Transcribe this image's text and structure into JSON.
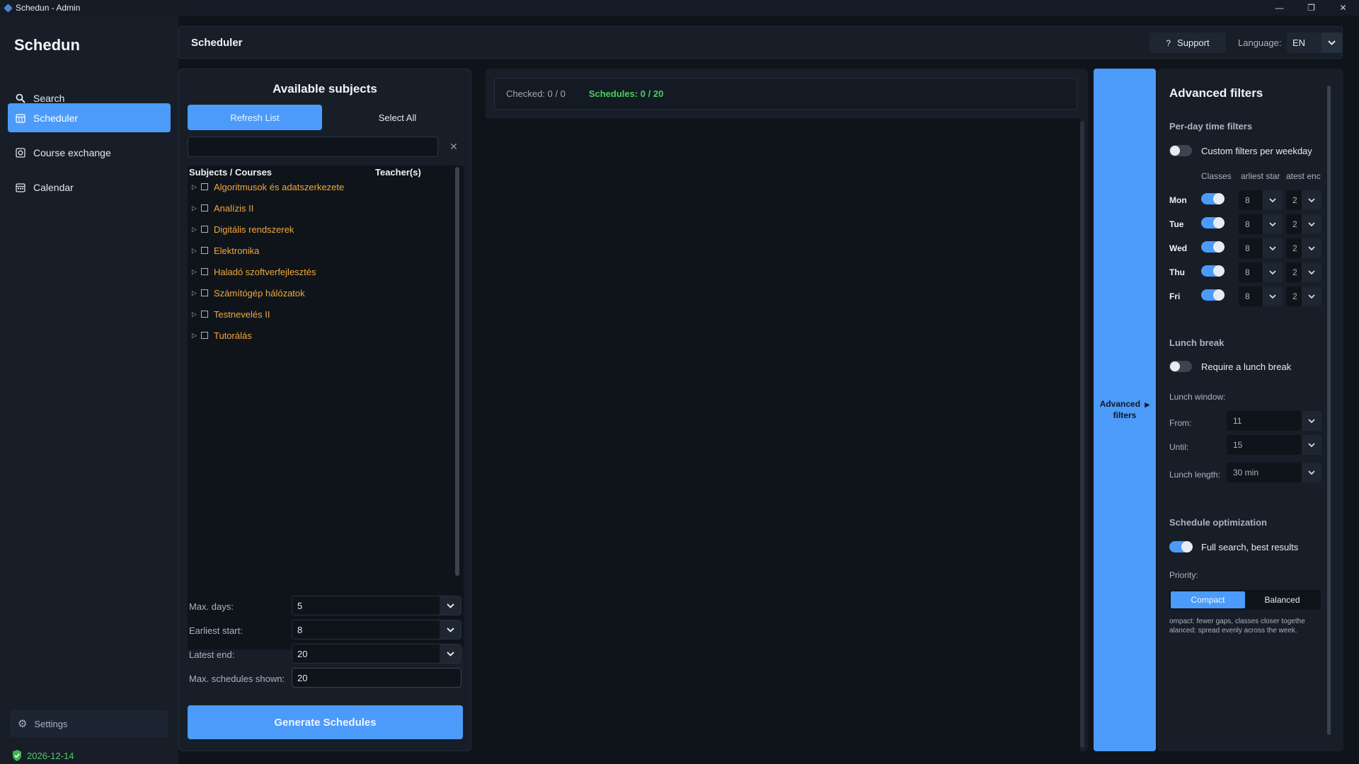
{
  "window": {
    "title": "Schedun - Admin"
  },
  "sidebar": {
    "logo": "Schedun",
    "items": [
      {
        "label": "Search",
        "icon": "search-icon"
      },
      {
        "label": "Scheduler",
        "icon": "calendar-grid-icon",
        "active": true
      },
      {
        "label": "Course exchange",
        "icon": "exchange-icon"
      },
      {
        "label": "Calendar",
        "icon": "calendar-icon"
      }
    ],
    "settings_label": "Settings",
    "license_date": "2026-12-14"
  },
  "header": {
    "title": "Scheduler",
    "support_label": "Support",
    "language_label": "Language:",
    "language_value": "EN"
  },
  "subjects": {
    "title": "Available subjects",
    "refresh_label": "Refresh List",
    "select_all_label": "Select All",
    "search_value": "",
    "col_subjects": "Subjects / Courses",
    "col_teachers": "Teacher(s)",
    "items": [
      "Algoritmusok és adatszerkezete",
      "Analízis II",
      "Digitális rendszerek",
      "Elektronika",
      "Haladó szoftverfejlesztés",
      "Számítógép hálózatok",
      "Testnevelés II",
      "Tutorálás"
    ],
    "fields": {
      "max_days_label": "Max. days:",
      "max_days": "5",
      "earliest_start_label": "Earliest start:",
      "earliest_start": "8",
      "latest_end_label": "Latest end:",
      "latest_end": "20",
      "max_shown_label": "Max. schedules shown:",
      "max_shown": "20"
    },
    "generate_label": "Generate Schedules"
  },
  "results": {
    "checked_text": "Checked: 0 / 0",
    "schedules_text": "Schedules: 0 / 20"
  },
  "advanced": {
    "toggle_label_1": "Advanced",
    "toggle_label_2": "filters",
    "toggle_arrow": "▶",
    "title": "Advanced filters",
    "per_day_title": "Per-day time filters",
    "custom_label": "Custom filters per weekday",
    "col_classes": "Classes",
    "col_start": "arliest star",
    "col_end": "atest enc",
    "days": [
      {
        "name": "Mon",
        "start": "8",
        "end": "2"
      },
      {
        "name": "Tue",
        "start": "8",
        "end": "2"
      },
      {
        "name": "Wed",
        "start": "8",
        "end": "2"
      },
      {
        "name": "Thu",
        "start": "8",
        "end": "2"
      },
      {
        "name": "Fri",
        "start": "8",
        "end": "2"
      }
    ],
    "lunch_title": "Lunch break",
    "lunch_require_label": "Require a lunch break",
    "lunch_window_label": "Lunch window:",
    "from_label": "From:",
    "from_value": "11",
    "until_label": "Until:",
    "until_value": "15",
    "length_label": "Lunch length:",
    "length_value": "30 min",
    "opt_title": "Schedule optimization",
    "full_search_label": "Full search, best results",
    "priority_label": "Priority:",
    "priority_options": [
      "Compact",
      "Balanced"
    ],
    "hint1": "ompact: fewer gaps, classes closer togethe",
    "hint2": "alanced: spread evenly across the week.",
    "accent": "#4c9bfa"
  }
}
